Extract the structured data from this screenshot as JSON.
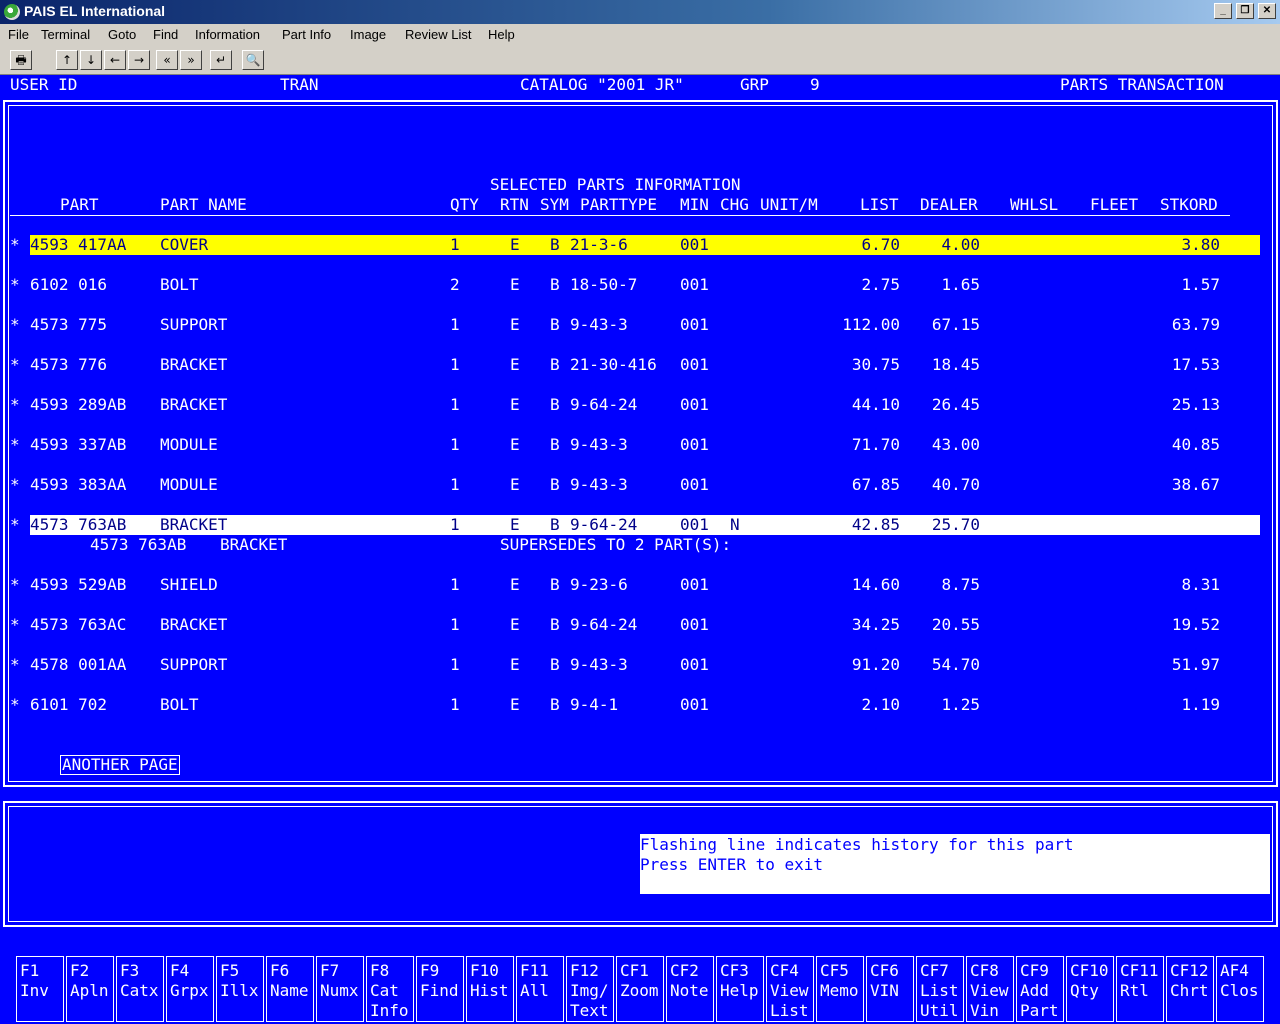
{
  "window": {
    "title": "PAIS EL International"
  },
  "menu": [
    "File",
    "Terminal",
    "Goto",
    "Find",
    "Information",
    "Part Info",
    "Image",
    "Review List",
    "Help"
  ],
  "toolbar": {
    "print": "🖶",
    "up": "↑",
    "down": "↓",
    "left": "←",
    "right": "→",
    "prev": "«",
    "next": "»",
    "enter": "↵",
    "zoom": "🔍"
  },
  "header": {
    "user_id": "USER ID",
    "tran": "TRAN",
    "catalog": "CATALOG \"2001 JR\"",
    "grp": "GRP",
    "grp_value": "9",
    "screen": "PARTS TRANSACTION"
  },
  "section_title": "SELECTED PARTS INFORMATION",
  "columns": {
    "part": "PART",
    "part_name": "PART NAME",
    "qty": "QTY",
    "rtn": "RTN",
    "sym": "SYM",
    "parttype": "PARTTYPE",
    "min": "MIN",
    "chg": "CHG",
    "unit": "UNIT/M",
    "list": "LIST",
    "dealer": "DEALER",
    "whlsl": "WHLSL",
    "fleet": "FLEET",
    "stkord": "STKORD"
  },
  "rows": [
    {
      "star": "*",
      "part": "4593 417AA",
      "name": "COVER",
      "qty": "1",
      "rtn": "E",
      "sym": "B",
      "ptype": "21-3-6",
      "min": "001",
      "chg": "",
      "list": "6.70",
      "dealer": "4.00",
      "stkord": "3.80"
    },
    {
      "star": "*",
      "part": "6102 016",
      "name": "BOLT",
      "qty": "2",
      "rtn": "E",
      "sym": "B",
      "ptype": "18-50-7",
      "min": "001",
      "chg": "",
      "list": "2.75",
      "dealer": "1.65",
      "stkord": "1.57"
    },
    {
      "star": "*",
      "part": "4573 775",
      "name": "SUPPORT",
      "qty": "1",
      "rtn": "E",
      "sym": "B",
      "ptype": "9-43-3",
      "min": "001",
      "chg": "",
      "list": "112.00",
      "dealer": "67.15",
      "stkord": "63.79"
    },
    {
      "star": "*",
      "part": "4573 776",
      "name": "BRACKET",
      "qty": "1",
      "rtn": "E",
      "sym": "B",
      "ptype": "21-30-416",
      "min": "001",
      "chg": "",
      "list": "30.75",
      "dealer": "18.45",
      "stkord": "17.53"
    },
    {
      "star": "*",
      "part": "4593 289AB",
      "name": "BRACKET",
      "qty": "1",
      "rtn": "E",
      "sym": "B",
      "ptype": "9-64-24",
      "min": "001",
      "chg": "",
      "list": "44.10",
      "dealer": "26.45",
      "stkord": "25.13"
    },
    {
      "star": "*",
      "part": "4593 337AB",
      "name": "MODULE",
      "qty": "1",
      "rtn": "E",
      "sym": "B",
      "ptype": "9-43-3",
      "min": "001",
      "chg": "",
      "list": "71.70",
      "dealer": "43.00",
      "stkord": "40.85"
    },
    {
      "star": "*",
      "part": "4593 383AA",
      "name": "MODULE",
      "qty": "1",
      "rtn": "E",
      "sym": "B",
      "ptype": "9-43-3",
      "min": "001",
      "chg": "",
      "list": "67.85",
      "dealer": "40.70",
      "stkord": "38.67"
    },
    {
      "star": "*",
      "part": "4573 763AB",
      "name": "BRACKET",
      "qty": "1",
      "rtn": "E",
      "sym": "B",
      "ptype": "9-64-24",
      "min": "001",
      "chg": "N",
      "list": "42.85",
      "dealer": "25.70",
      "stkord": ""
    },
    {
      "star": "*",
      "part": "4593 529AB",
      "name": "SHIELD",
      "qty": "1",
      "rtn": "E",
      "sym": "B",
      "ptype": "9-23-6",
      "min": "001",
      "chg": "",
      "list": "14.60",
      "dealer": "8.75",
      "stkord": "8.31"
    },
    {
      "star": "*",
      "part": "4573 763AC",
      "name": "BRACKET",
      "qty": "1",
      "rtn": "E",
      "sym": "B",
      "ptype": "9-64-24",
      "min": "001",
      "chg": "",
      "list": "34.25",
      "dealer": "20.55",
      "stkord": "19.52"
    },
    {
      "star": "*",
      "part": "4578 001AA",
      "name": "SUPPORT",
      "qty": "1",
      "rtn": "E",
      "sym": "B",
      "ptype": "9-43-3",
      "min": "001",
      "chg": "",
      "list": "91.20",
      "dealer": "54.70",
      "stkord": "51.97"
    },
    {
      "star": "*",
      "part": "6101 702",
      "name": "BOLT",
      "qty": "1",
      "rtn": "E",
      "sym": "B",
      "ptype": "9-4-1",
      "min": "001",
      "chg": "",
      "list": "2.10",
      "dealer": "1.25",
      "stkord": "1.19"
    }
  ],
  "supersede": {
    "part": "4573 763AB",
    "name": "BRACKET",
    "text": "SUPERSEDES TO 2 PART(S):"
  },
  "another_page": "ANOTHER PAGE",
  "messages": [
    "Flashing line indicates history for this part",
    "Press ENTER to exit"
  ],
  "fkeys": [
    "F1\nInv",
    "F2\nApln",
    "F3\nCatx",
    "F4\nGrpx",
    "F5\nIllx",
    "F6\nName",
    "F7\nNumx",
    "F8\nCat\nInfo",
    "F9\nFind",
    "F10\nHist",
    "F11\nAll",
    "F12\nImg/\nText",
    "CF1\nZoom",
    "CF2\nNote",
    "CF3\nHelp",
    "CF4\nView\nList",
    "CF5\nMemo",
    "CF6\nVIN",
    "CF7\nList\nUtil",
    "CF8\nView\nVin",
    "CF9\nAdd\nPart",
    "CF10\nQty",
    "CF11\nRtl",
    "CF12\nChrt",
    "AF4\nClos"
  ]
}
